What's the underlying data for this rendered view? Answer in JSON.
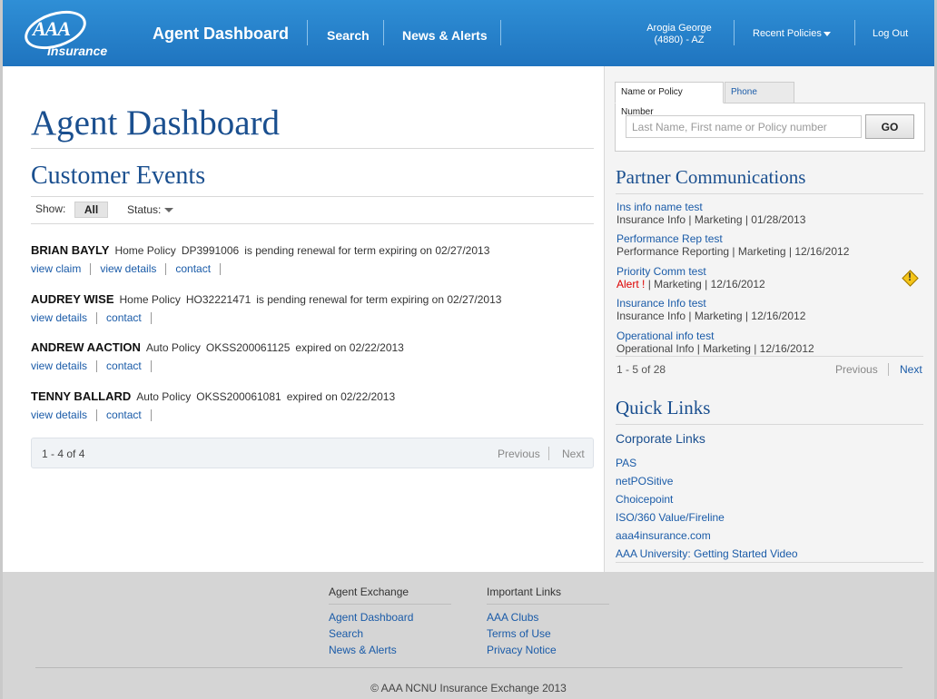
{
  "header": {
    "logo_text": "AAA",
    "logo_sub": "Insurance",
    "title": "Agent Dashboard",
    "nav": [
      "Search",
      "News & Alerts"
    ],
    "user_name": "Arogia George",
    "user_code": "(4880) - AZ",
    "recent": "Recent Policies",
    "logout": "Log Out"
  },
  "main": {
    "title": "Agent Dashboard",
    "section_title": "Customer Events",
    "show_label": "Show:",
    "show_value": "All",
    "status_label": "Status:",
    "events": [
      {
        "name": "BRIAN BAYLY",
        "policy": "Home Policy",
        "number": "DP3991006",
        "status": "is pending renewal for term expiring on 02/27/2013",
        "actions": [
          "view claim",
          "view details",
          "contact"
        ]
      },
      {
        "name": "AUDREY WISE",
        "policy": "Home Policy",
        "number": "HO32221471",
        "status": "is pending renewal for term expiring on 02/27/2013",
        "actions": [
          "view details",
          "contact"
        ]
      },
      {
        "name": "ANDREW AACTION",
        "policy": "Auto Policy",
        "number": "OKSS200061125",
        "status": "expired on 02/22/2013",
        "actions": [
          "view details",
          "contact"
        ]
      },
      {
        "name": "TENNY BALLARD",
        "policy": "Auto Policy",
        "number": "OKSS200061081",
        "status": "expired on 02/22/2013",
        "actions": [
          "view details",
          "contact"
        ]
      }
    ],
    "pager": {
      "count": "1 - 4 of 4",
      "prev": "Previous",
      "next": "Next"
    }
  },
  "sidebar": {
    "tabs": [
      "Name or Policy Number",
      "Phone number"
    ],
    "search_placeholder": "Last Name, First name or Policy number",
    "go_label": "GO",
    "partner_title": "Partner Communications",
    "comms": [
      {
        "title": "Ins info name test",
        "meta": "Insurance Info | Marketing | 01/28/2013"
      },
      {
        "title": "Performance Rep test",
        "meta": "Performance Reporting | Marketing | 12/16/2012"
      },
      {
        "title": "Priority Comm test",
        "alert": "Alert !",
        "meta": "| Marketing | 12/16/2012"
      },
      {
        "title": "Insurance Info test",
        "meta": "Insurance Info | Marketing | 12/16/2012"
      },
      {
        "title": "Operational info test",
        "meta": "Operational Info | Marketing | 12/16/2012"
      }
    ],
    "comm_pager": {
      "count": "1 - 5 of 28",
      "prev": "Previous",
      "next": "Next"
    },
    "quick_title": "Quick Links",
    "corp_title": "Corporate Links",
    "links": [
      "PAS",
      "netPOSitive",
      "Choicepoint",
      "ISO/360 Value/Fireline",
      "aaa4insurance.com",
      "AAA University: Getting Started Video"
    ]
  },
  "footer": {
    "col1_title": "Agent Exchange",
    "col1_links": [
      "Agent Dashboard",
      "Search",
      "News & Alerts"
    ],
    "col2_title": "Important Links",
    "col2_links": [
      "AAA Clubs",
      "Terms of Use",
      "Privacy Notice"
    ],
    "copyright": "© AAA NCNU Insurance Exchange 2013"
  }
}
